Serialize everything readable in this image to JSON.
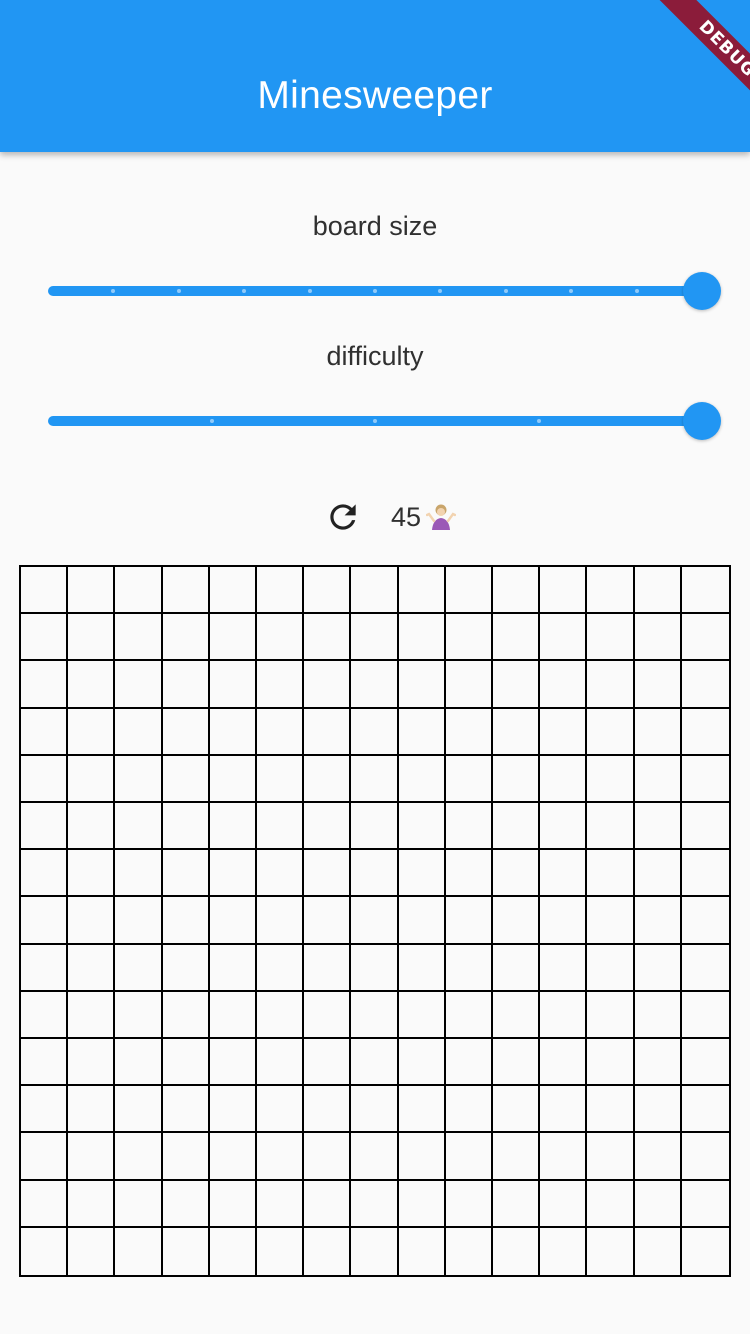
{
  "appbar": {
    "title": "Minesweeper",
    "debug_banner": "DEBUG"
  },
  "board_size": {
    "label": "board size",
    "value_fraction": 1.0,
    "divisions": 10
  },
  "difficulty": {
    "label": "difficulty",
    "value_fraction": 1.0,
    "divisions": 4
  },
  "status": {
    "mine_count": "45",
    "emoji_icon": "person-shrugging-icon",
    "refresh_icon": "refresh-icon"
  },
  "board": {
    "rows": 15,
    "cols": 15
  },
  "colors": {
    "primary": "#2196F3",
    "tick": "#90CAF9",
    "debug": "#8b1c3a",
    "grid": "#000000"
  }
}
